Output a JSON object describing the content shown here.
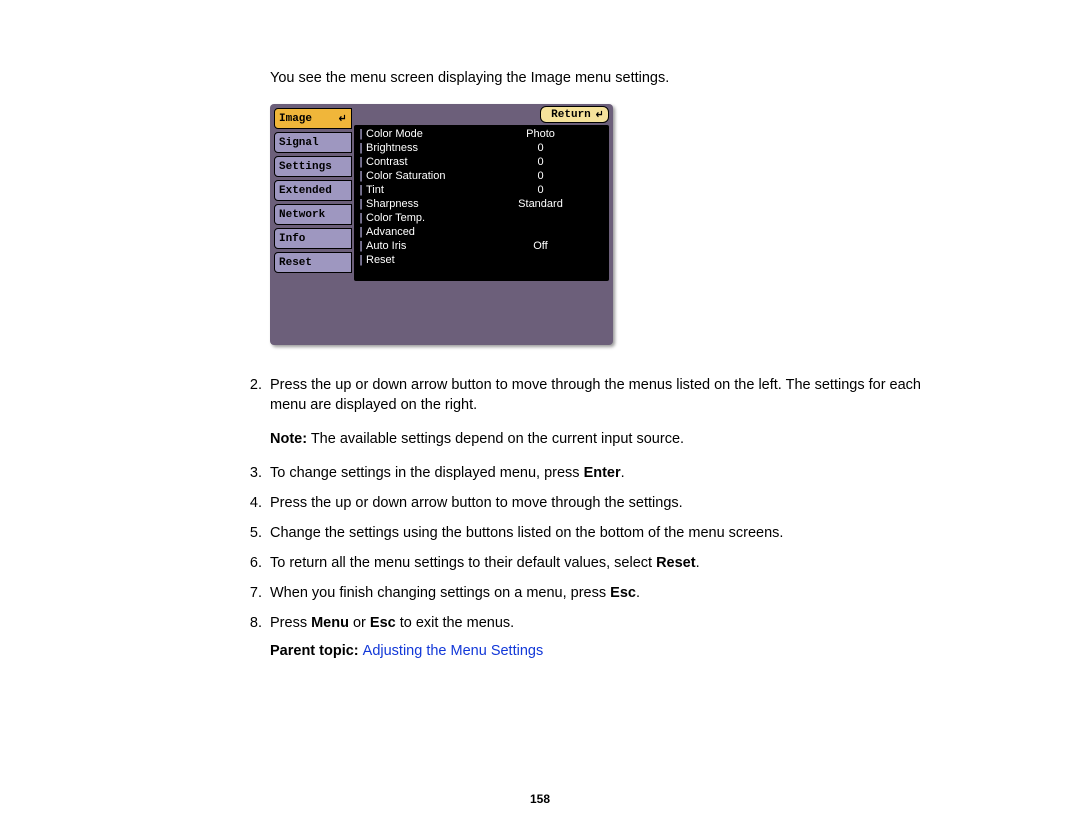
{
  "intro": "You see the menu screen displaying the Image menu settings.",
  "osd": {
    "tabs": [
      "Image",
      "Signal",
      "Settings",
      "Extended",
      "Network",
      "Info",
      "Reset"
    ],
    "return": "Return",
    "settings": [
      {
        "label": "Color Mode",
        "value": "Photo"
      },
      {
        "label": "Brightness",
        "value": "0"
      },
      {
        "label": "Contrast",
        "value": "0"
      },
      {
        "label": "Color Saturation",
        "value": "0"
      },
      {
        "label": "Tint",
        "value": "0"
      },
      {
        "label": "Sharpness",
        "value": "Standard"
      },
      {
        "label": "Color Temp.",
        "value": ""
      },
      {
        "label": "Advanced",
        "value": ""
      },
      {
        "label": "Auto Iris",
        "value": "Off"
      },
      {
        "label": "Reset",
        "value": ""
      }
    ]
  },
  "steps": {
    "s2": {
      "num": "2.",
      "a": "Press the up or down arrow button to move through the menus listed on the left. The settings for each menu are displayed on the right."
    },
    "s3": {
      "num": "3.",
      "a": "To change settings in the displayed menu, press ",
      "b": "Enter",
      "c": "."
    },
    "s4": {
      "num": "4.",
      "a": "Press the up or down arrow button to move through the settings."
    },
    "s5": {
      "num": "5.",
      "a": "Change the settings using the buttons listed on the bottom of the menu screens."
    },
    "s6": {
      "num": "6.",
      "a": "To return all the menu settings to their default values, select ",
      "b": "Reset",
      "c": "."
    },
    "s7": {
      "num": "7.",
      "a": "When you finish changing settings on a menu, press ",
      "b": "Esc",
      "c": "."
    },
    "s8": {
      "num": "8.",
      "a": "Press ",
      "b": "Menu",
      "c": " or ",
      "d": "Esc",
      "e": " to exit the menus."
    }
  },
  "note": {
    "lead": "Note:",
    "text": " The available settings depend on the current input source."
  },
  "parent": {
    "lead": "Parent topic: ",
    "link": "Adjusting the Menu Settings"
  },
  "pagenum": "158"
}
